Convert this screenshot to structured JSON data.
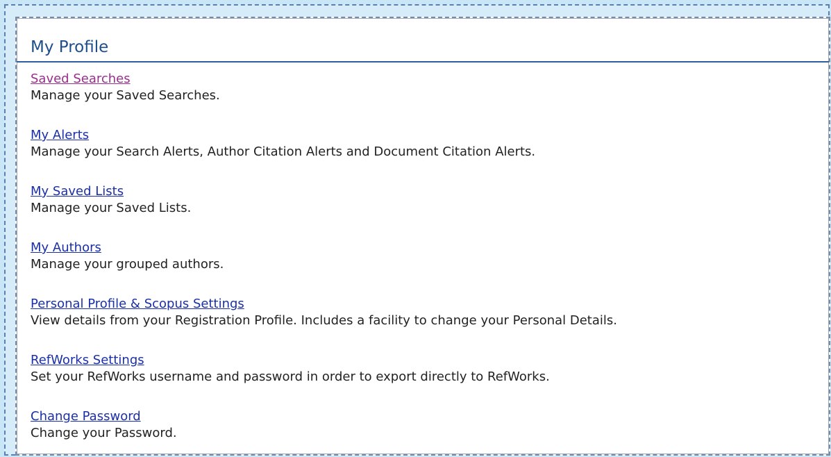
{
  "profile": {
    "title": "My Profile",
    "items": [
      {
        "link": "Saved Searches",
        "description": "Manage your Saved Searches."
      },
      {
        "link": "My Alerts",
        "description": "Manage your Search Alerts, Author Citation Alerts and Document Citation Alerts."
      },
      {
        "link": "My Saved Lists",
        "description": "Manage your Saved Lists."
      },
      {
        "link": "My Authors",
        "description": "Manage your grouped authors."
      },
      {
        "link": "Personal Profile & Scopus Settings",
        "description": "View details from your Registration Profile. Includes a facility to change your Personal Details."
      },
      {
        "link": "RefWorks Settings",
        "description": "Set your RefWorks username and password in order to export directly to RefWorks."
      },
      {
        "link": "Change Password",
        "description": "Change your Password."
      }
    ]
  },
  "colors": {
    "link": "#1a2fa8",
    "visited_link": "#9b2d8f",
    "title": "#1f4f8a",
    "header_rule": "#2f5d9b",
    "background": "#c8e6f5"
  }
}
